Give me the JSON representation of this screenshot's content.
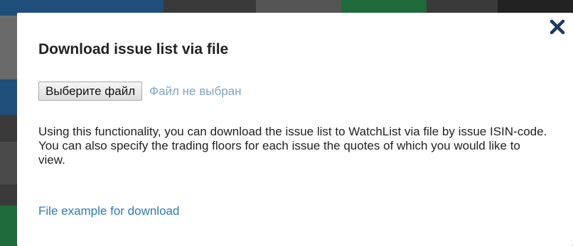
{
  "dialog": {
    "title": "Download issue list via file",
    "close_icon": "close-icon",
    "file_input": {
      "button_label": "Выберите файл",
      "status_text": "Файл не выбран"
    },
    "description": "Using this functionality, you can download the issue list to WatchList via file by issue ISIN-code. You can also specify the trading floors for each issue the quotes of which you would like to view.",
    "example_link": "File example for download"
  },
  "colors": {
    "overlay": "#3a3a3a",
    "link": "#2e7ab8",
    "file_status": "#7fa6c4",
    "close_icon": "#1b3a5c"
  }
}
